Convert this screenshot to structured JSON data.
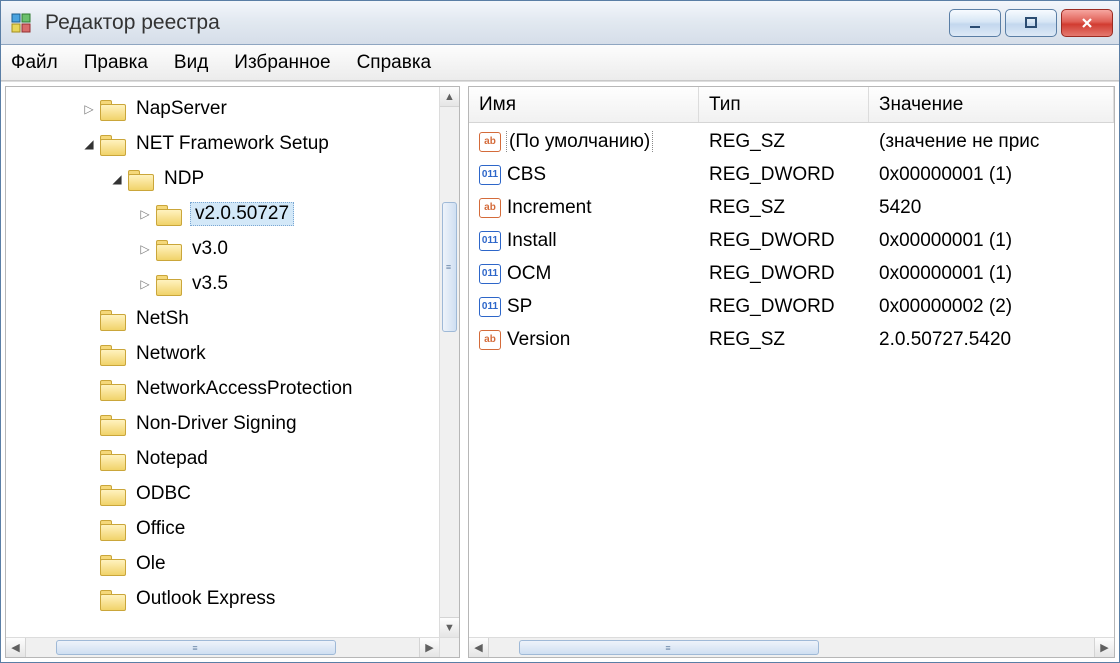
{
  "title": "Редактор реестра",
  "menu": {
    "file": "Файл",
    "edit": "Правка",
    "view": "Вид",
    "favorites": "Избранное",
    "help": "Справка"
  },
  "tree": {
    "items": [
      {
        "label": "NapServer",
        "depth": 2,
        "glyph": "collapsed",
        "selected": false
      },
      {
        "label": "NET Framework Setup",
        "depth": 2,
        "glyph": "expanded",
        "selected": false
      },
      {
        "label": "NDP",
        "depth": 3,
        "glyph": "expanded",
        "selected": false
      },
      {
        "label": "v2.0.50727",
        "depth": 4,
        "glyph": "collapsed",
        "selected": true
      },
      {
        "label": "v3.0",
        "depth": 4,
        "glyph": "collapsed",
        "selected": false
      },
      {
        "label": "v3.5",
        "depth": 4,
        "glyph": "collapsed",
        "selected": false
      },
      {
        "label": "NetSh",
        "depth": 2,
        "glyph": "none",
        "selected": false
      },
      {
        "label": "Network",
        "depth": 2,
        "glyph": "none",
        "selected": false
      },
      {
        "label": "NetworkAccessProtection",
        "depth": 2,
        "glyph": "none",
        "selected": false
      },
      {
        "label": "Non-Driver Signing",
        "depth": 2,
        "glyph": "none",
        "selected": false
      },
      {
        "label": "Notepad",
        "depth": 2,
        "glyph": "none",
        "selected": false
      },
      {
        "label": "ODBC",
        "depth": 2,
        "glyph": "none",
        "selected": false
      },
      {
        "label": "Office",
        "depth": 2,
        "glyph": "none",
        "selected": false
      },
      {
        "label": "Ole",
        "depth": 2,
        "glyph": "none",
        "selected": false
      },
      {
        "label": "Outlook Express",
        "depth": 2,
        "glyph": "none",
        "selected": false
      }
    ]
  },
  "list": {
    "columns": {
      "name": "Имя",
      "type": "Тип",
      "data": "Значение"
    },
    "rows": [
      {
        "icon": "sz",
        "name": "(По умолчанию)",
        "type": "REG_SZ",
        "data": "(значение не прис",
        "default": true
      },
      {
        "icon": "dw",
        "name": "CBS",
        "type": "REG_DWORD",
        "data": "0x00000001 (1)",
        "default": false
      },
      {
        "icon": "sz",
        "name": "Increment",
        "type": "REG_SZ",
        "data": "5420",
        "default": false
      },
      {
        "icon": "dw",
        "name": "Install",
        "type": "REG_DWORD",
        "data": "0x00000001 (1)",
        "default": false
      },
      {
        "icon": "dw",
        "name": "OCM",
        "type": "REG_DWORD",
        "data": "0x00000001 (1)",
        "default": false
      },
      {
        "icon": "dw",
        "name": "SP",
        "type": "REG_DWORD",
        "data": "0x00000002 (2)",
        "default": false
      },
      {
        "icon": "sz",
        "name": "Version",
        "type": "REG_SZ",
        "data": "2.0.50727.5420",
        "default": false
      }
    ]
  },
  "icons": {
    "sz_text": "ab",
    "dw_text": "011"
  }
}
